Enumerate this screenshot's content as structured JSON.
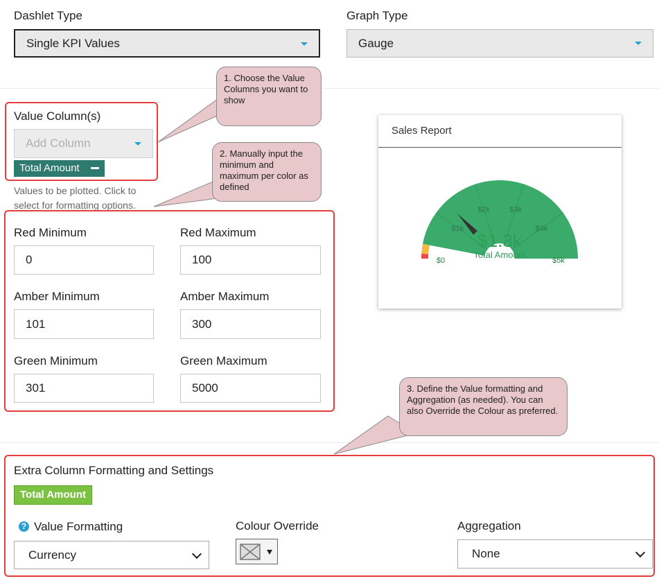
{
  "dashlet": {
    "type_label": "Dashlet Type",
    "type_value": "Single KPI Values",
    "graph_label": "Graph Type",
    "graph_value": "Gauge"
  },
  "value_columns": {
    "label": "Value Column(s)",
    "placeholder": "Add Column",
    "chip": "Total Amount",
    "help": [
      "Values to be plotted. Click to",
      "select for formatting options."
    ]
  },
  "ranges": {
    "red_min_label": "Red Minimum",
    "red_min": "0",
    "red_max_label": "Red Maximum",
    "red_max": "100",
    "amber_min_label": "Amber Minimum",
    "amber_min": "101",
    "amber_max_label": "Amber Maximum",
    "amber_max": "300",
    "green_min_label": "Green Minimum",
    "green_min": "301",
    "green_max_label": "Green Maximum",
    "green_max": "5000"
  },
  "preview": {
    "title": "Sales Report",
    "gauge_value": "$1.3k",
    "gauge_label": "Total Amount",
    "needle_value": 1300,
    "min": 0,
    "max": 5000,
    "bands": [
      {
        "from": 0,
        "to": 100,
        "color": "#e84c4c"
      },
      {
        "from": 101,
        "to": 300,
        "color": "#f4b942"
      },
      {
        "from": 301,
        "to": 5000,
        "color": "#3aab6a"
      }
    ],
    "ticks": [
      "$0",
      "$1k",
      "$2k",
      "$3k",
      "$4k",
      "$5k"
    ]
  },
  "callouts": {
    "one": "1. Choose the Value Columns you want to show",
    "two": "2. Manually input the minimum and maximum  per color as defined",
    "three": "3. Define the Value formatting and Aggregation (as needed). You can also Override the Colour as preferred."
  },
  "extra": {
    "title": "Extra Column Formatting and Settings",
    "tag": "Total Amount",
    "value_formatting_label": "Value Formatting",
    "value_formatting": "Currency",
    "colour_override_label": "Colour Override",
    "aggregation_label": "Aggregation",
    "aggregation": "None"
  },
  "colors": {
    "accent": "#2a9fd6",
    "chip": "#2f7a6e",
    "tag": "#7cc242",
    "annotation_border": "#e53c3c",
    "callout_fill": "#e8c8ca"
  }
}
